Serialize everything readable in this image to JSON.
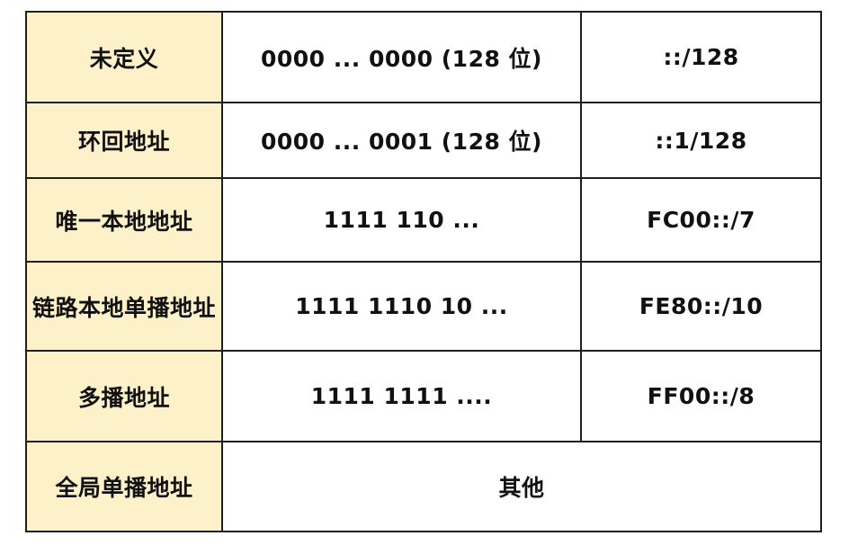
{
  "table": {
    "rows": [
      {
        "type": "未定义",
        "binary_prefix": "0000 ... 0000 (128 位)",
        "notation": "::/128"
      },
      {
        "type": "环回地址",
        "binary_prefix": "0000 ... 0001 (128 位)",
        "notation": "::1/128"
      },
      {
        "type": "唯一本地地址",
        "binary_prefix": "1111 110 ...",
        "notation": "FC00::/7"
      },
      {
        "type": "链路本地单播地址",
        "binary_prefix": "1111 1110 10 ...",
        "notation": "FE80::/10"
      },
      {
        "type": "多播地址",
        "binary_prefix": "1111 1111 ....",
        "notation": "FF00::/8"
      },
      {
        "type": "全局单播地址",
        "merged_value": "其他"
      }
    ]
  },
  "colors": {
    "type_column_background": "#fdf1ca",
    "value_background": "#ffffff",
    "border": "#1f1f1f",
    "text": "#111111"
  }
}
